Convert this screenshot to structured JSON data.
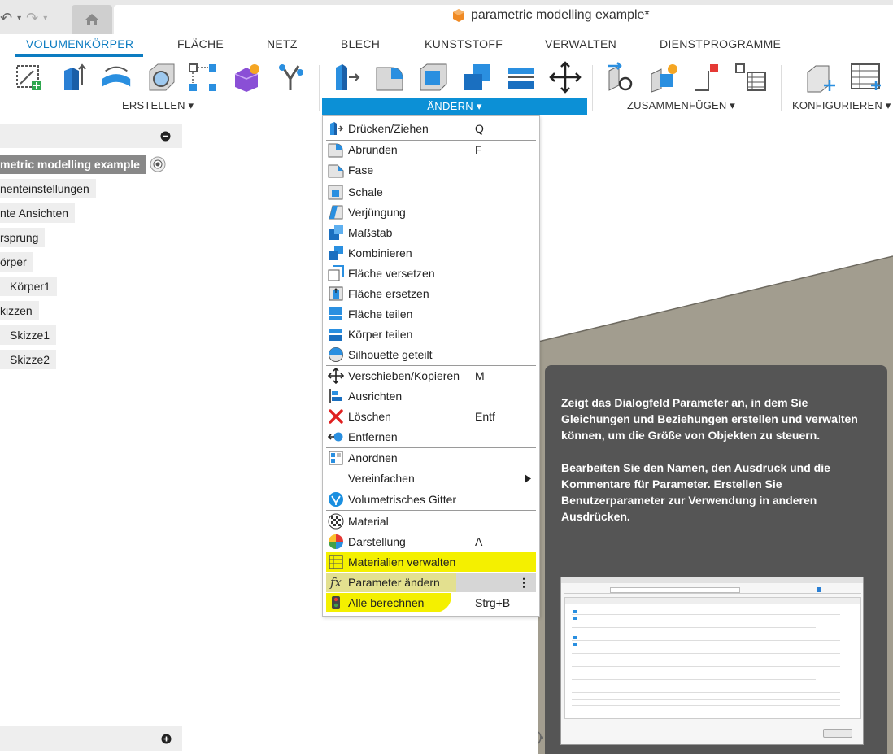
{
  "title_bar": {
    "document_title": "parametric modelling example*"
  },
  "ribbon": {
    "tabs": [
      "VOLUMENKÖRPER",
      "FLÄCHE",
      "NETZ",
      "BLECH",
      "KUNSTSTOFF",
      "VERWALTEN",
      "DIENSTPROGRAMME"
    ],
    "active_tab": "VOLUMENKÖRPER",
    "groups": {
      "erstellen": "ERSTELLEN ▾",
      "aendern": "ÄNDERN ▾",
      "zusammenfuegen": "ZUSAMMENFÜGEN ▾",
      "konfigurieren": "KONFIGURIEREN ▾"
    }
  },
  "browser": {
    "items": [
      "metric modelling example",
      "nenteinstellungen",
      "nte Ansichten",
      "rsprung",
      "örper",
      "Körper1",
      "kizzen",
      "Skizze1",
      "Skizze2"
    ]
  },
  "menu": {
    "items": [
      {
        "label": "Drücken/Ziehen",
        "shortcut": "Q",
        "icon": "press-pull-icon"
      },
      {
        "label": "Abrunden",
        "shortcut": "F",
        "icon": "fillet-icon"
      },
      {
        "label": "Fase",
        "shortcut": "",
        "icon": "chamfer-icon"
      },
      {
        "label": "Schale",
        "shortcut": "",
        "icon": "shell-icon"
      },
      {
        "label": "Verjüngung",
        "shortcut": "",
        "icon": "draft-icon"
      },
      {
        "label": "Maßstab",
        "shortcut": "",
        "icon": "scale-icon"
      },
      {
        "label": "Kombinieren",
        "shortcut": "",
        "icon": "combine-icon"
      },
      {
        "label": "Fläche versetzen",
        "shortcut": "",
        "icon": "offset-face-icon"
      },
      {
        "label": "Fläche ersetzen",
        "shortcut": "",
        "icon": "replace-face-icon"
      },
      {
        "label": "Fläche teilen",
        "shortcut": "",
        "icon": "split-face-icon"
      },
      {
        "label": "Körper teilen",
        "shortcut": "",
        "icon": "split-body-icon"
      },
      {
        "label": "Silhouette geteilt",
        "shortcut": "",
        "icon": "silhouette-split-icon"
      },
      {
        "label": "Verschieben/Kopieren",
        "shortcut": "M",
        "icon": "move-icon"
      },
      {
        "label": "Ausrichten",
        "shortcut": "",
        "icon": "align-icon"
      },
      {
        "label": "Löschen",
        "shortcut": "Entf",
        "icon": "delete-icon"
      },
      {
        "label": "Entfernen",
        "shortcut": "",
        "icon": "remove-icon"
      },
      {
        "label": "Anordnen",
        "shortcut": "",
        "icon": "arrange-icon"
      },
      {
        "label": "Vereinfachen",
        "shortcut": "",
        "icon": "submenu-arrow-icon"
      },
      {
        "label": "Volumetrisches Gitter",
        "shortcut": "",
        "icon": "volumetric-lattice-icon"
      },
      {
        "label": "Material",
        "shortcut": "",
        "icon": "material-icon"
      },
      {
        "label": "Darstellung",
        "shortcut": "A",
        "icon": "appearance-icon"
      },
      {
        "label": "Materialien verwalten",
        "shortcut": "",
        "icon": "manage-materials-icon"
      },
      {
        "label": "Parameter ändern",
        "shortcut": "",
        "icon": "fx-icon"
      },
      {
        "label": "Alle berechnen",
        "shortcut": "Strg+B",
        "icon": "compute-all-icon"
      }
    ]
  },
  "tooltip": {
    "paragraph1": "Zeigt das Dialogfeld Parameter an, in dem Sie Gleichungen und Beziehungen erstellen und verwalten können, um die Größe von Objekten zu steuern.",
    "paragraph2": "Bearbeiten Sie den Namen, den Ausdruck und die Kommentare für Parameter. Erstellen Sie Benutzerparameter zur Verwendung in anderen Ausdrücken."
  },
  "colors": {
    "accent_blue": "#0c7cc1",
    "highlight_yellow": "#f4f000",
    "tooltip_bg": "#555555"
  }
}
